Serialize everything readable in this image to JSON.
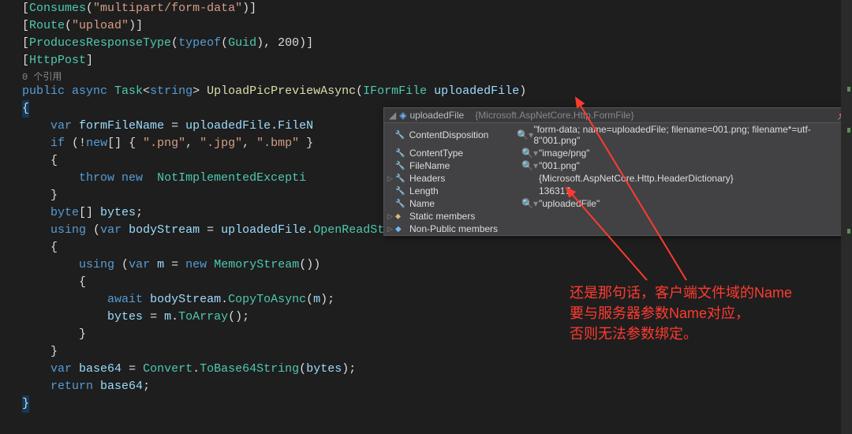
{
  "refs_label": "0 个引用",
  "code": {
    "l1_attr": "Consumes",
    "l1_str": "\"multipart/form-data\"",
    "l2_attr": "Route",
    "l2_str": "\"upload\"",
    "l3_attr": "ProducesResponseType",
    "l3_kw": "typeof",
    "l3_ty": "Guid",
    "l3_num": "200",
    "l4_attr": "HttpPost",
    "l5_mods": "public async ",
    "l5_task": "Task",
    "l5_gen": "string",
    "l5_meth": "UploadPicPreviewAsync",
    "l5_pty": "IFormFile",
    "l5_pn": "uploadedFile",
    "l7_var": "var",
    "l7_id": "formFileName",
    "l7_rhs1": "uploadedFile",
    "l7_rhs2": "FileN",
    "l8_if": "if",
    "l8_new": "new",
    "l8_s1": "\".png\"",
    "l8_s2": "\".jpg\"",
    "l8_s3": "\".bmp\"",
    "l10_throw": "throw",
    "l10_new": "new",
    "l10_ty": "NotImplementedExcepti",
    "l12_ty": "byte",
    "l12_id": "bytes",
    "l13_using": "using",
    "l13_var": "var",
    "l13_id": "bodyStream",
    "l13_rhs1": "uploadedFile",
    "l13_rhs2": "OpenReadStream",
    "l15_using": "using",
    "l15_var": "var",
    "l15_id": "m",
    "l15_new": "new",
    "l15_ty": "MemoryStream",
    "l18_await": "await",
    "l18_id": "bodyStream",
    "l18_m": "CopyToAsync",
    "l18_arg": "m",
    "l19_lhs": "bytes",
    "l19_rhs1": "m",
    "l19_rhs2": "ToArray",
    "l22_var": "var",
    "l22_id": "base64",
    "l22_ty": "Convert",
    "l22_m": "ToBase64String",
    "l22_arg": "bytes",
    "l23_ret": "return",
    "l23_id": "base64"
  },
  "tooltip": {
    "header_name": "uploadedFile",
    "header_type": "{Microsoft.AspNetCore.Http.FormFile}",
    "pin": "📌",
    "rows": [
      {
        "icon": "wrench",
        "name": "ContentDisposition",
        "sep": "🔍▾",
        "val": "\"form-data; name=uploadedFile; filename=001.png; filename*=utf-8''001.png\""
      },
      {
        "icon": "wrench",
        "name": "ContentType",
        "sep": "🔍▾",
        "val": "\"image/png\""
      },
      {
        "icon": "wrench",
        "name": "FileName",
        "sep": "🔍▾",
        "val": "\"001.png\""
      },
      {
        "icon": "wrench",
        "name": "Headers",
        "sep": "",
        "val": "{Microsoft.AspNetCore.Http.HeaderDictionary}",
        "exp": true
      },
      {
        "icon": "wrench",
        "name": "Length",
        "sep": "",
        "val": "136317"
      },
      {
        "icon": "wrench",
        "name": "Name",
        "sep": "🔍▾",
        "val": "\"uploadedFile\""
      },
      {
        "icon": "yellow",
        "name": "Static members",
        "sep": "",
        "val": "",
        "exp": true
      },
      {
        "icon": "blue",
        "name": "Non-Public members",
        "sep": "",
        "val": "",
        "exp": true
      }
    ]
  },
  "annotation": {
    "line1": "还是那句话，客户端文件域的Name",
    "line2": "要与服务器参数Name对应，",
    "line3": "否则无法参数绑定。"
  }
}
